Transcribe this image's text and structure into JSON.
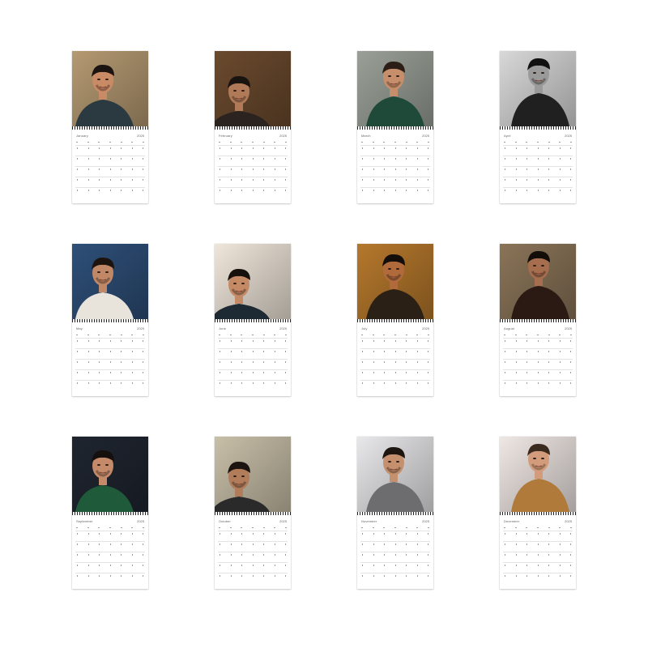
{
  "calendar": {
    "months": [
      {
        "name": "January",
        "year": "2025",
        "photo": "man-leaning-on-arm-warm-room",
        "colors": {
          "bg": "#b59a72",
          "shirt": "#2b3a40",
          "skin": "#c98b66",
          "hair": "#1c1410"
        }
      },
      {
        "name": "February",
        "year": "2025",
        "photo": "man-lying-on-bed-dark-room",
        "colors": {
          "bg": "#6b4a2e",
          "shirt": "#2a2320",
          "skin": "#b07a58",
          "hair": "#1a1411"
        }
      },
      {
        "name": "March",
        "year": "2025",
        "photo": "man-in-green-jacket",
        "colors": {
          "bg": "#9aa098",
          "shirt": "#1f4a3a",
          "skin": "#c68e6a",
          "hair": "#2a1e16"
        }
      },
      {
        "name": "April",
        "year": "2025",
        "photo": "man-black-and-white-portrait",
        "colors": {
          "bg": "#d8d8d8",
          "shirt": "#202020",
          "skin": "#9a9a9a",
          "hair": "#111111"
        }
      },
      {
        "name": "May",
        "year": "2025",
        "photo": "man-in-tank-top-blue-wall",
        "colors": {
          "bg": "#2e4f78",
          "shirt": "#e8e4dc",
          "skin": "#c08866",
          "hair": "#1d140f"
        }
      },
      {
        "name": "June",
        "year": "2025",
        "photo": "man-close-up-portrait",
        "colors": {
          "bg": "#efe6da",
          "shirt": "#1d2a33",
          "skin": "#c48a66",
          "hair": "#17110d"
        }
      },
      {
        "name": "July",
        "year": "2025",
        "photo": "man-hand-on-chin-golden-light",
        "colors": {
          "bg": "#b5782c",
          "shirt": "#2a2016",
          "skin": "#b06a3c",
          "hair": "#140e0a"
        }
      },
      {
        "name": "August",
        "year": "2025",
        "photo": "man-reclining-in-leather-jacket",
        "colors": {
          "bg": "#8a7458",
          "shirt": "#2b1a14",
          "skin": "#a66e4e",
          "hair": "#130d0a"
        }
      },
      {
        "name": "September",
        "year": "2025",
        "photo": "man-in-green-sweater-side-profile",
        "colors": {
          "bg": "#1f2530",
          "shirt": "#1f5a3a",
          "skin": "#c48a6a",
          "hair": "#15100d"
        }
      },
      {
        "name": "October",
        "year": "2025",
        "photo": "man-sitting-on-stool",
        "colors": {
          "bg": "#c8bfa8",
          "shirt": "#2a2a2a",
          "skin": "#b07c5a",
          "hair": "#1b1410"
        }
      },
      {
        "name": "November",
        "year": "2025",
        "photo": "man-holding-glasses-patterned-shirt",
        "colors": {
          "bg": "#e8e8ea",
          "shirt": "#6d6d70",
          "skin": "#c4906e",
          "hair": "#1c1510"
        }
      },
      {
        "name": "December",
        "year": "2025",
        "photo": "man-resting-on-pillow-knit-sweater",
        "colors": {
          "bg": "#efe7e4",
          "shirt": "#b07a3a",
          "skin": "#d29c7c",
          "hair": "#3a2a1e"
        }
      }
    ]
  }
}
